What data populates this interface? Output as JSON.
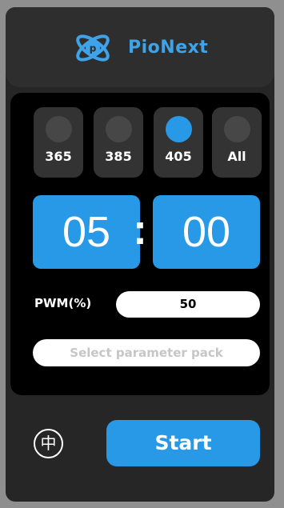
{
  "header": {
    "brand_name": "PioNext",
    "logo_icon": "atom-orbit-logo-icon",
    "accent_color": "#2799e6"
  },
  "wavelengths": [
    {
      "label": "365",
      "selected": false
    },
    {
      "label": "385",
      "selected": false
    },
    {
      "label": "405",
      "selected": true
    },
    {
      "label": "All",
      "selected": false
    }
  ],
  "timer": {
    "minutes": "05",
    "separator": ":",
    "seconds": "00"
  },
  "pwm": {
    "label": "PWM(%)",
    "value": "50"
  },
  "parameter_pack": {
    "placeholder": "Select parameter pack"
  },
  "footer": {
    "language_glyph": "中",
    "start_label": "Start"
  }
}
